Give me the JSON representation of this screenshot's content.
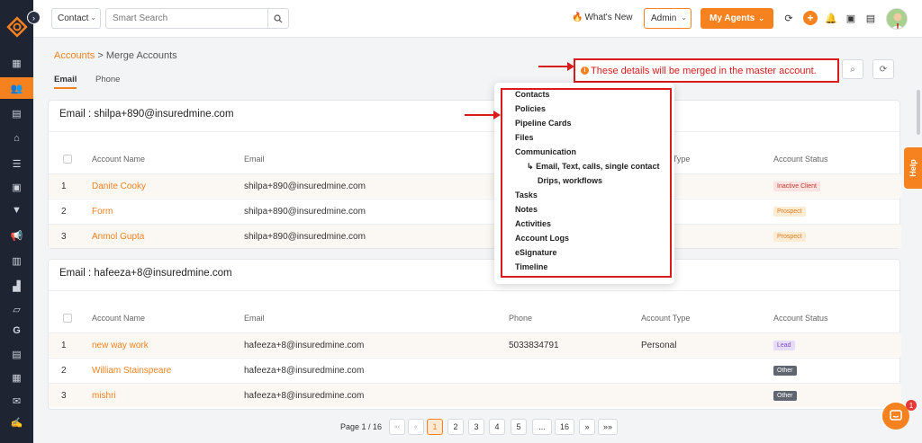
{
  "topbar": {
    "contact_select": "Contact",
    "search_placeholder": "Smart Search",
    "whats_new": "What's New",
    "role_select": "Admin",
    "agents_button": "My Agents"
  },
  "page": {
    "breadcrumb_parent": "Accounts",
    "breadcrumb_sep": ">",
    "breadcrumb_current": "Merge Accounts",
    "tabs": [
      "Email",
      "Phone"
    ],
    "notice": "These details will be merged in the master account."
  },
  "table_headers": [
    "Account Name",
    "Email",
    "Phone",
    "Account Type",
    "Account Status"
  ],
  "groups": [
    {
      "title": "Email : shilpa+890@insuredmine.com",
      "rows": [
        {
          "num": "1",
          "name": "Danite Cooky",
          "email": "shilpa+890@insuredmine.com",
          "phone": "",
          "type": "",
          "status": "Inactive Client"
        },
        {
          "num": "2",
          "name": "Form",
          "email": "shilpa+890@insuredmine.com",
          "phone": "",
          "type": "",
          "status": "Prospect"
        },
        {
          "num": "3",
          "name": "Anmol Gupta",
          "email": "shilpa+890@insuredmine.com",
          "phone": "",
          "type": "",
          "status": "Prospect"
        }
      ]
    },
    {
      "title": "Email : hafeeza+8@insuredmine.com",
      "rows": [
        {
          "num": "1",
          "name": "new way work",
          "email": "hafeeza+8@insuredmine.com",
          "phone": "5033834791",
          "type": "Personal",
          "status": "Lead"
        },
        {
          "num": "2",
          "name": "William Stainspeare",
          "email": "hafeeza+8@insuredmine.com",
          "phone": "",
          "type": "",
          "status": "Other"
        },
        {
          "num": "3",
          "name": "mishri",
          "email": "hafeeza+8@insuredmine.com",
          "phone": "",
          "type": "",
          "status": "Other"
        }
      ]
    }
  ],
  "popover": {
    "items": [
      "Contacts",
      "Policies",
      "Pipeline Cards",
      "Files",
      "Communication"
    ],
    "sub_items": [
      "Email, Text, calls, single contact",
      "Drips, workflows"
    ],
    "sub_arrow": "↳",
    "items_after": [
      "Tasks",
      "Notes",
      "Activities",
      "Account Logs",
      "eSignature",
      "Timeline"
    ]
  },
  "pagination": {
    "label": "Page 1 / 16",
    "first": "«‹",
    "prev": "«",
    "pages": [
      "1",
      "2",
      "3",
      "4",
      "5",
      "...",
      "16"
    ],
    "next": "»",
    "last": "»»"
  },
  "help_label": "Help",
  "chat_badge": "1",
  "status_colors": {
    "Inactive Client": {
      "bg": "#fde2e2",
      "fg": "#c0392b"
    },
    "Prospect": {
      "bg": "#fdebd3",
      "fg": "#e67e22"
    },
    "Lead": {
      "bg": "#e6dcf7",
      "fg": "#7b4fc2"
    },
    "Other": {
      "bg": "#5f6670",
      "fg": "#ffffff"
    }
  },
  "accent_color": "#f5821f",
  "sidebar_icons": [
    "dashboard-icon",
    "accounts-icon",
    "documents-icon",
    "bank-icon",
    "list-icon",
    "contacts-icon",
    "filter-icon",
    "megaphone-icon",
    "notes-icon",
    "reports-icon",
    "folder-icon",
    "google-icon",
    "calendar-list-icon",
    "calendar-icon",
    "mail-icon",
    "signature-icon"
  ]
}
